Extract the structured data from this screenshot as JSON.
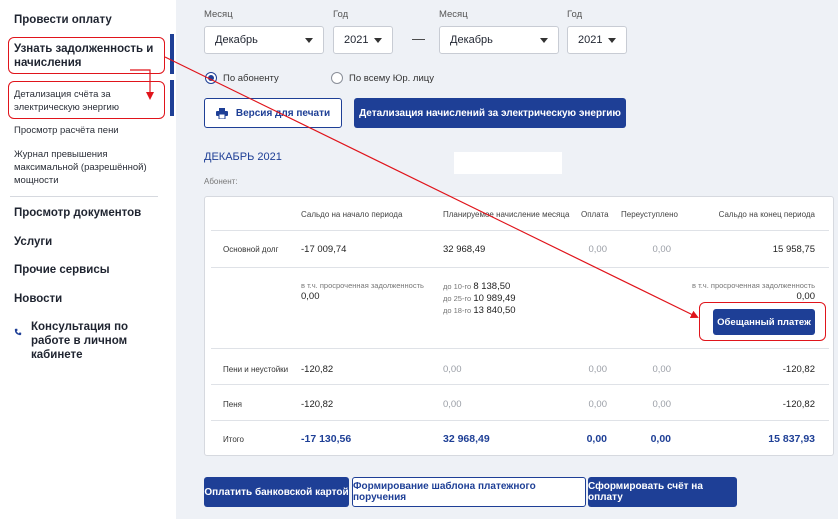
{
  "sidebar": {
    "pay": "Провести оплату",
    "debt": "Узнать задолженность и начисления",
    "detail": "Детализация счёта за электрическую энергию",
    "penalty_calc": "Просмотр расчёта пени",
    "excess_log": "Журнал превышения максимальной (разрешённой) мощности",
    "documents": "Просмотр документов",
    "services": "Услуги",
    "other": "Прочие сервисы",
    "news": "Новости",
    "consult": "Консультация по работе в личном кабинете"
  },
  "filters": {
    "month_label": "Месяц",
    "year_label": "Год",
    "from_month": "Декабрь",
    "from_year": "2021",
    "dash": "—",
    "to_month": "Декабрь",
    "to_year": "2021",
    "radio_subscriber": "По абоненту",
    "radio_all": "По всему Юр. лицу"
  },
  "actions": {
    "print": "Версия для печати",
    "detail_charges": "Детализация начислений за электрическую энергию"
  },
  "period_title": "ДЕКАБРЬ 2021",
  "abonent_label": "Абонент:",
  "table": {
    "headers": {
      "start": "Сальдо на начало периода",
      "planned": "Планируемое начисление месяца",
      "payment": "Оплата",
      "reassigned": "Переуступлено",
      "end": "Сальдо на конец периода"
    },
    "main_debt": {
      "label": "Основной долг",
      "start": "-17 009,74",
      "planned": "32 968,49",
      "payment": "0,00",
      "reassigned": "0,00",
      "end": "15 958,75"
    },
    "overdue": {
      "label_start": "в т.ч. просроченная задолженность",
      "start": "0,00",
      "sched1_label": "до 10-го",
      "sched1": "8 138,50",
      "sched2_label": "до 25-го",
      "sched2": "10 989,49",
      "sched3_label": "до 18-го",
      "sched3": "13 840,50",
      "label_end": "в т.ч. просроченная задолженность",
      "end": "0,00",
      "promise_button": "Обещанный платеж"
    },
    "fines": {
      "label": "Пени и неустойки",
      "start": "-120,82",
      "planned": "0,00",
      "payment": "0,00",
      "reassigned": "0,00",
      "end": "-120,82"
    },
    "penalty": {
      "label": "Пеня",
      "start": "-120,82",
      "planned": "0,00",
      "payment": "0,00",
      "reassigned": "0,00",
      "end": "-120,82"
    },
    "total": {
      "label": "Итого",
      "start": "-17 130,56",
      "planned": "32 968,49",
      "payment": "0,00",
      "reassigned": "0,00",
      "end": "15 837,93"
    }
  },
  "bottom": {
    "pay_card": "Оплатить банковской картой",
    "template": "Формирование шаблона платежного поручения",
    "invoice": "Сформировать счёт на оплату"
  },
  "colors": {
    "brand": "#1e3f96",
    "annotation": "#e0141b"
  }
}
